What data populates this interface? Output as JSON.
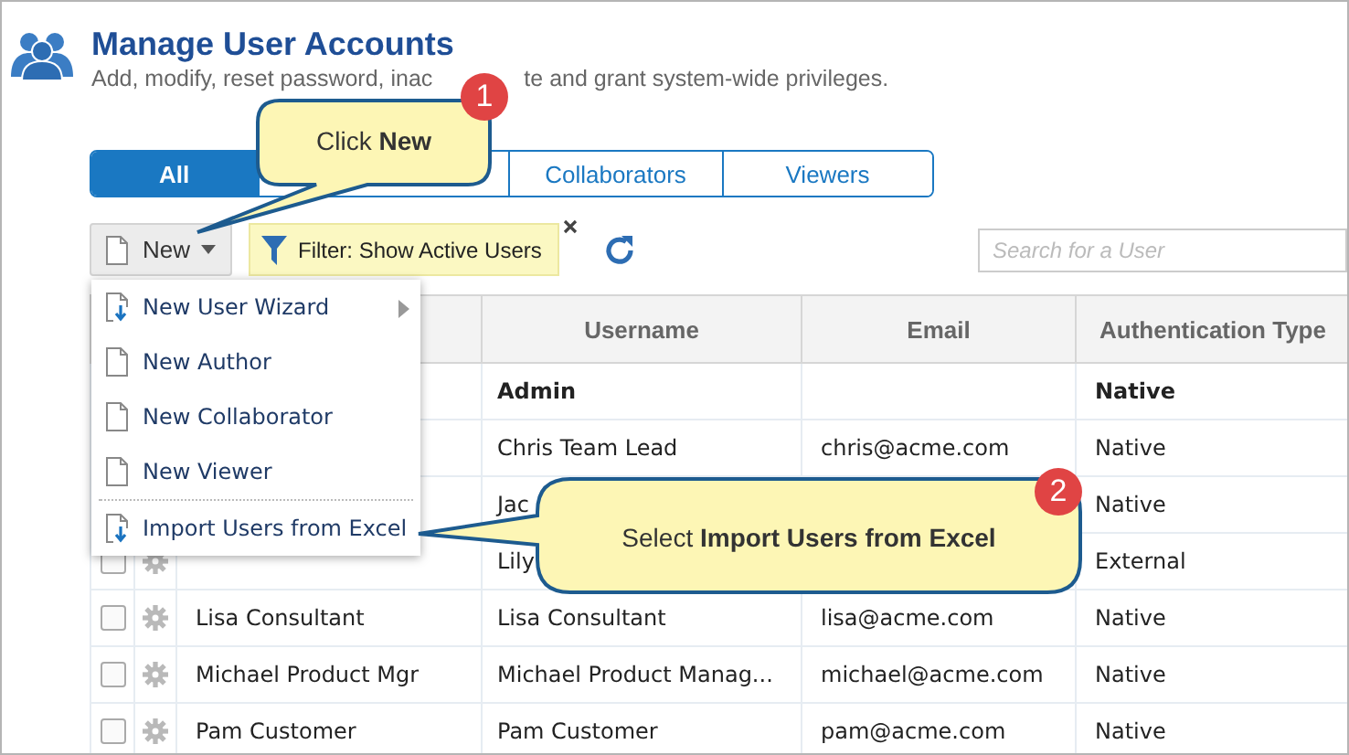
{
  "header": {
    "title": "Manage User Accounts",
    "subtitle_parts": [
      "Add, modify, reset password, inac",
      "te and grant system-wide privileges."
    ]
  },
  "tabs": [
    {
      "label": "All",
      "selected": true
    },
    {
      "selected": false
    },
    {
      "label": "Collaborators",
      "selected": false
    },
    {
      "label": "Viewers",
      "selected": false
    }
  ],
  "toolbar": {
    "new_button": "New",
    "filter": "Filter: Show Active Users",
    "search": {
      "placeholder": "Search for a User"
    }
  },
  "new_menu": [
    {
      "label": "New User Wizard",
      "kind": "import",
      "submenu": true
    },
    {
      "label": "New Author",
      "kind": "page",
      "submenu": false
    },
    {
      "label": "New Collaborator",
      "kind": "page",
      "submenu": false
    },
    {
      "label": "New Viewer",
      "kind": "page",
      "submenu": false
    },
    {
      "label": "Import Users from Excel",
      "kind": "import",
      "submenu": false,
      "separator_before": true
    }
  ],
  "table": {
    "columns": [
      "Username",
      "Email",
      "Authentication Type"
    ],
    "rows": [
      {
        "username": "Admin",
        "auth_type": "Native",
        "bold": true
      },
      {
        "username": "Chris Team Lead",
        "email": "chris@acme.com",
        "auth_type": "Native",
        "bold": false
      },
      {
        "username": "Jac",
        "auth_type": "Native",
        "bold": false
      },
      {
        "checked": false,
        "username": "Lily",
        "auth_type": "External",
        "bold": false
      },
      {
        "display_name": "Lisa Consultant",
        "checked": false,
        "username": "Lisa Consultant",
        "email": "lisa@acme.com",
        "auth_type": "Native",
        "bold": false
      },
      {
        "display_name": "Michael Product Mgr",
        "checked": false,
        "username": "Michael Product Manag...",
        "email": "michael@acme.com",
        "auth_type": "Native",
        "bold": false
      },
      {
        "display_name": "Pam Customer",
        "checked": false,
        "username": "Pam Customer",
        "email": "pam@acme.com",
        "auth_type": "Native",
        "bold": false
      }
    ]
  },
  "callouts": [
    {
      "step": "1",
      "text": "Click **New**"
    },
    {
      "step": "2",
      "text": "Select **Import Users from Excel**"
    }
  ]
}
